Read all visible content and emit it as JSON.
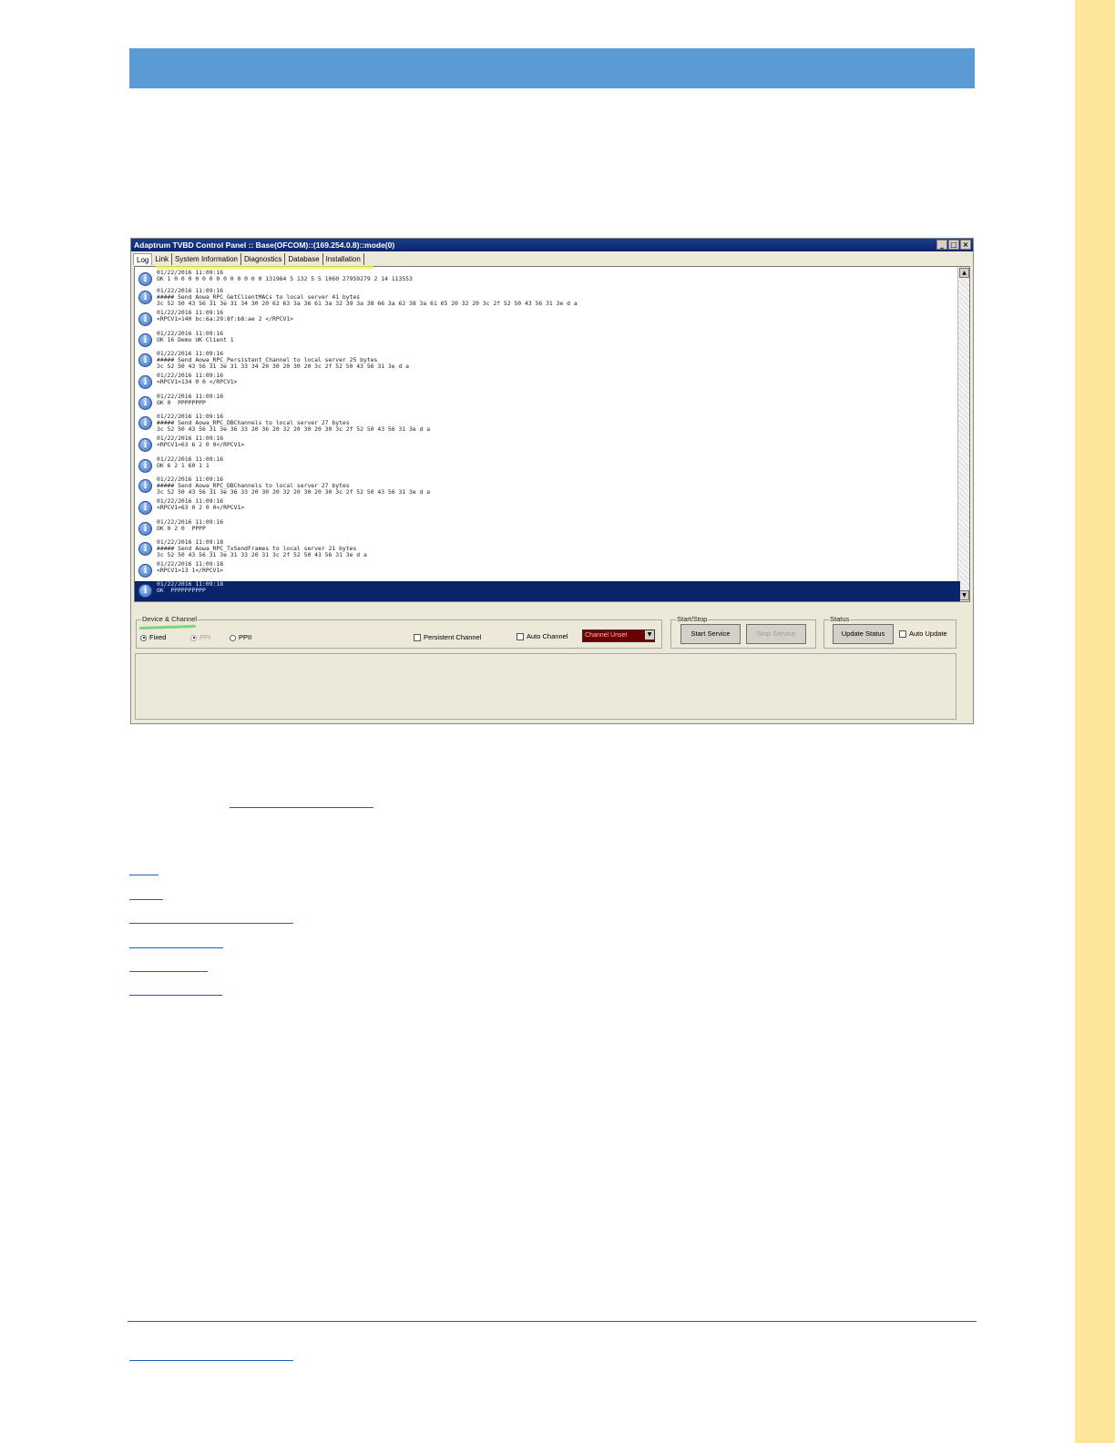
{
  "window": {
    "title": "Adaptrum TVBD Control Panel :: Base(OFCOM)::(169.254.0.8)::mode(0)",
    "controls": [
      "_",
      "□",
      "×"
    ]
  },
  "tabs": [
    "Log",
    "Link",
    "System Information",
    "Diagnostics",
    "Database",
    "Installation"
  ],
  "log_entries": [
    {
      "icon": "info-icon",
      "lines": [
        "01/22/2016 11:09:16",
        "OK 1 0 0 0 0 0 0 0 0 0 0 0 0 0 131964 5 132 5 5 1060 27959279 2 14 113553"
      ]
    },
    {
      "icon": "info-icon",
      "lines": [
        "01/22/2016 11:09:16",
        "##### Send Aowa_RPC_GetClientMACs to local server 41 bytes",
        "3c 52 50 43 56 31 3e 31 34 30 20 62 63 3a 36 61 3a 32 39 3a 38 66 3a 62 38 3a 61 65 20 32 20 3c 2f 52 50 43 56 31 3e d a"
      ]
    },
    {
      "icon": "info-icon",
      "lines": [
        "01/22/2016 11:09:16",
        "<RPCV1>140 bc:6a:29:8f:b8:ae 2 </RPCV1>"
      ]
    },
    {
      "icon": "info-icon",
      "lines": [
        "01/22/2016 11:09:16",
        "OK 16 Demo UK Client 1"
      ]
    },
    {
      "icon": "info-icon",
      "lines": [
        "01/22/2016 11:09:16",
        "##### Send Aowa_RPC_Persistent_Channel to local server 25 bytes",
        "3c 52 50 43 56 31 3e 31 33 34 20 30 20 30 20 3c 2f 52 50 43 56 31 3e d a"
      ]
    },
    {
      "icon": "info-icon",
      "lines": [
        "01/22/2016 11:09:16",
        "<RPCV1>134 0 0 </RPCV1>"
      ]
    },
    {
      "icon": "info-icon",
      "lines": [
        "01/22/2016 11:09:16",
        "OK 0  PPPPPPPP"
      ]
    },
    {
      "icon": "info-icon",
      "lines": [
        "01/22/2016 11:09:16",
        "##### Send Aowa_RPC_DBChannels to local server 27 bytes",
        "3c 52 50 43 56 31 3e 36 33 20 36 20 32 20 30 20 30 3c 2f 52 50 43 56 31 3e d a"
      ]
    },
    {
      "icon": "info-icon",
      "lines": [
        "01/22/2016 11:09:16",
        "<RPCV1>63 6 2 0 0</RPCV1>"
      ]
    },
    {
      "icon": "info-icon",
      "lines": [
        "01/22/2016 11:09:16",
        "OK 6 2 1 60 1 1"
      ]
    },
    {
      "icon": "info-icon",
      "lines": [
        "01/22/2016 11:09:16",
        "##### Send Aowa_RPC_DBChannels to local server 27 bytes",
        "3c 52 50 43 56 31 3e 36 33 20 30 20 32 20 30 20 30 3c 2f 52 50 43 56 31 3e d a"
      ]
    },
    {
      "icon": "info-icon",
      "lines": [
        "01/22/2016 11:09:16",
        "<RPCV1>63 0 2 0 0</RPCV1>"
      ]
    },
    {
      "icon": "info-icon",
      "lines": [
        "01/22/2016 11:09:16",
        "OK 0 2 0  PPPP"
      ]
    },
    {
      "icon": "info-icon",
      "lines": [
        "01/22/2016 11:09:18",
        "##### Send Aowa_RPC_TxSendFrames to local server 21 bytes",
        "3c 52 50 43 56 31 3e 31 33 20 31 3c 2f 52 50 43 56 31 3e d a"
      ]
    },
    {
      "icon": "info-icon",
      "lines": [
        "01/22/2016 11:09:18",
        "<RPCV1>13 1</RPCV1>"
      ]
    },
    {
      "icon": "info-icon",
      "selected": true,
      "lines": [
        "01/22/2016 11:09:18",
        "OK  PPPPPPPPPP"
      ]
    }
  ],
  "device_channel": {
    "legend": "Device & Channel",
    "radios": [
      {
        "label": "Fixed",
        "checked": true,
        "disabled": false
      },
      {
        "label": "PPI",
        "checked": true,
        "disabled": true
      },
      {
        "label": "PPII",
        "checked": false,
        "disabled": false
      }
    ],
    "persistent_channel_label": "Persistent Channel",
    "auto_channel_label": "Auto Channel",
    "channel_select_value": "Channel Unset"
  },
  "start_stop": {
    "legend": "Start/Stop",
    "start_label": "Start Service",
    "stop_label": "Stop Service"
  },
  "status": {
    "legend": "Status",
    "update_label": "Update Status",
    "auto_update_label": "Auto Update"
  },
  "colors": {
    "header_band": "#5b9bd5",
    "side_bar": "#fde69a",
    "selection": "#0a246a",
    "channel_select_bg": "#6b0000"
  }
}
